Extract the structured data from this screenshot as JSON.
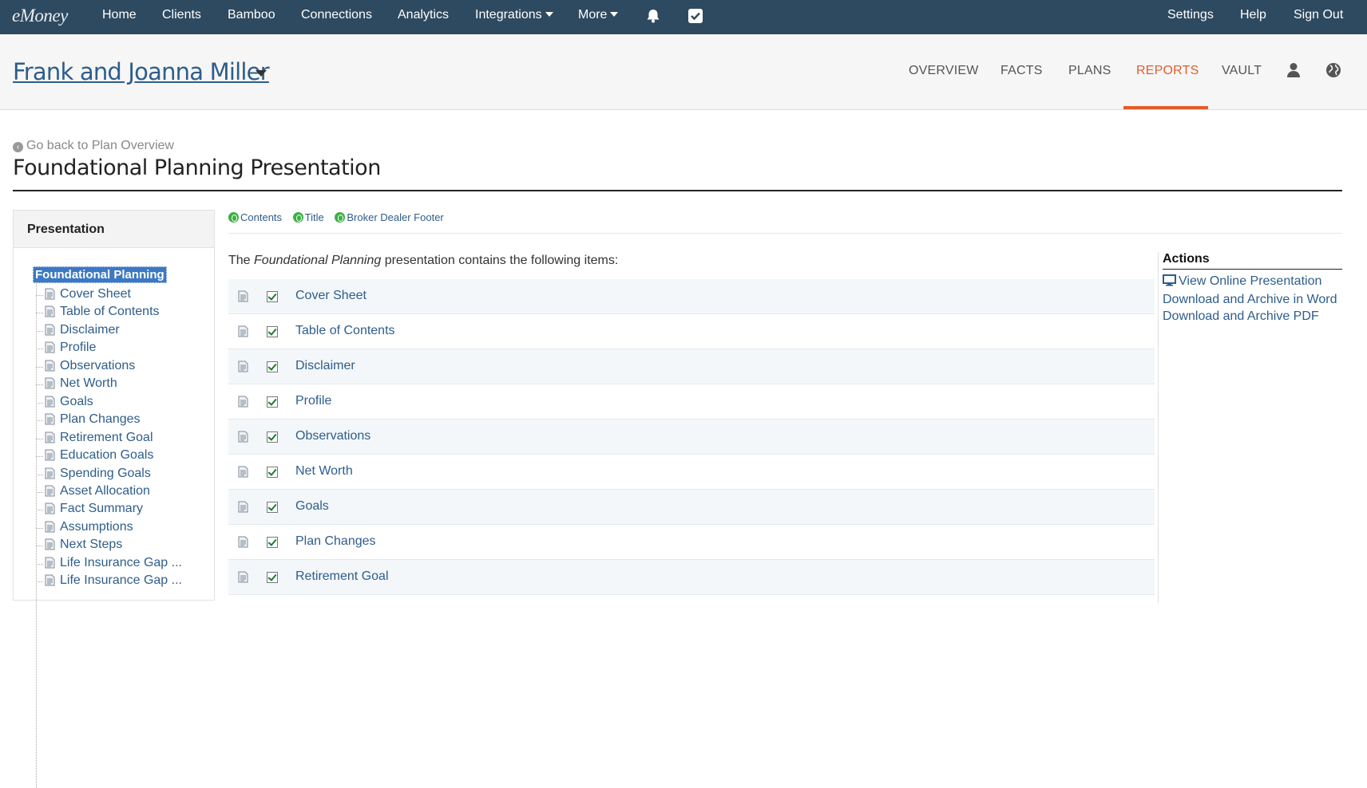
{
  "topnav": {
    "logo": "eMoney",
    "items": [
      "Home",
      "Clients",
      "Bamboo",
      "Connections",
      "Analytics",
      "Integrations",
      "More"
    ],
    "right": [
      "Settings",
      "Help",
      "Sign Out"
    ]
  },
  "client": {
    "name": "Frank and Joanna Miller",
    "tabs": [
      "OVERVIEW",
      "FACTS",
      "PLANS",
      "REPORTS",
      "VAULT"
    ],
    "active_tab": "REPORTS"
  },
  "page": {
    "back_link": "Go back to Plan Overview",
    "title": "Foundational Planning Presentation"
  },
  "sidebar": {
    "heading": "Presentation",
    "root": "Foundational Planning",
    "items": [
      "Cover Sheet",
      "Table of Contents",
      "Disclaimer",
      "Profile",
      "Observations",
      "Net Worth",
      "Goals",
      "Plan Changes",
      "Retirement Goal",
      "Education Goals",
      "Spending Goals",
      "Asset Allocation",
      "Fact Summary",
      "Assumptions",
      "Next Steps",
      "Life Insurance Gap ...",
      "Life Insurance Gap ..."
    ]
  },
  "options": {
    "chips": [
      "Contents",
      "Title",
      "Broker Dealer Footer"
    ]
  },
  "main": {
    "intro_prefix": "The ",
    "intro_em": "Foundational Planning",
    "intro_suffix": " presentation contains the following items:",
    "items": [
      "Cover Sheet",
      "Table of Contents",
      "Disclaimer",
      "Profile",
      "Observations",
      "Net Worth",
      "Goals",
      "Plan Changes",
      "Retirement Goal"
    ]
  },
  "actions": {
    "heading": "Actions",
    "links": [
      "View Online Presentation",
      "Download and Archive in Word",
      "Download and Archive PDF"
    ]
  },
  "colors": {
    "topbar": "#2e4a60",
    "link": "#2e5d8a",
    "accent": "#e35d2b",
    "selected": "#3d78c2"
  }
}
